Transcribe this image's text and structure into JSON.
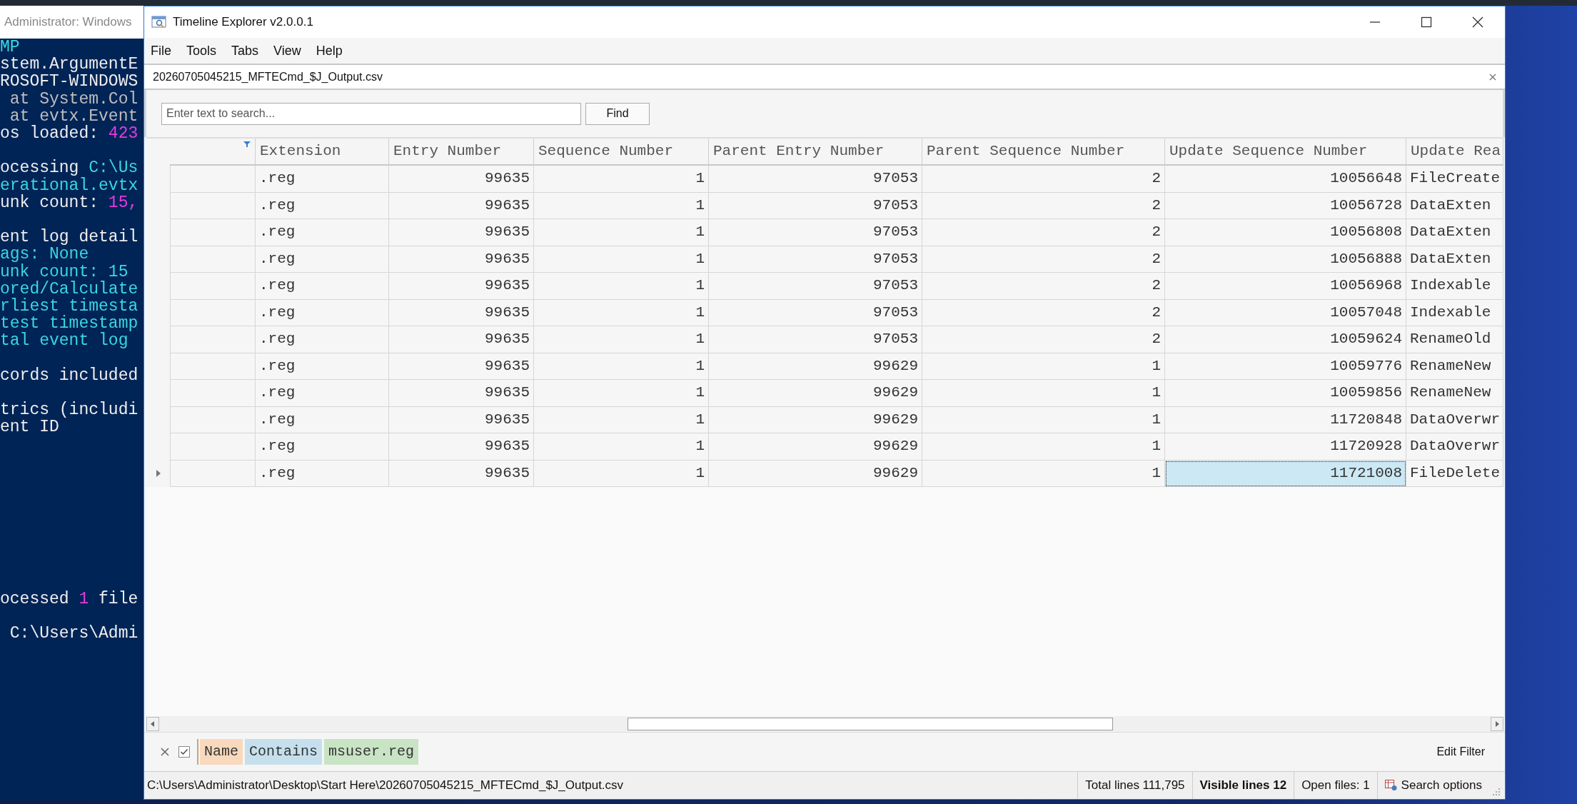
{
  "terminal": {
    "title": "Administrator: Windows",
    "blocks": [
      {
        "lines": [
          [
            {
              "text": "MP",
              "color": "#3ad6e0"
            }
          ],
          [
            {
              "text": "stem.ArgumentE",
              "color": "#eeeeee"
            }
          ],
          [
            {
              "text": "ROSOFT-WINDOWS",
              "color": "#eeeeee"
            }
          ],
          [
            {
              "text": " at System.Col",
              "color": "#bdbdbd"
            }
          ],
          [
            {
              "text": " at evtx.Event",
              "color": "#bdbdbd"
            }
          ],
          [
            {
              "text": "os loaded: ",
              "color": "#eeeeee"
            },
            {
              "text": "423",
              "color": "#e23be2"
            }
          ]
        ]
      },
      {
        "lines": [
          [
            {
              "text": "ocessing ",
              "color": "#eeeeee"
            },
            {
              "text": "C:\\Us",
              "color": "#3ad6e0"
            }
          ],
          [
            {
              "text": "erational.evtx",
              "color": "#3ad6e0"
            }
          ],
          [
            {
              "text": "unk count: ",
              "color": "#eeeeee"
            },
            {
              "text": "15,",
              "color": "#e23be2"
            }
          ]
        ]
      },
      {
        "lines": [
          [
            {
              "text": "ent log detail",
              "color": "#eeeeee"
            }
          ],
          [
            {
              "text": "ags: None",
              "color": "#3ad6e0"
            }
          ],
          [
            {
              "text": "unk count: 15",
              "color": "#3ad6e0"
            }
          ],
          [
            {
              "text": "ored/Calculate",
              "color": "#3ad6e0"
            }
          ],
          [
            {
              "text": "rliest timesta",
              "color": "#3ad6e0"
            }
          ],
          [
            {
              "text": "test timestamp",
              "color": "#3ad6e0"
            }
          ],
          [
            {
              "text": "tal event log",
              "color": "#3ad6e0"
            }
          ]
        ]
      },
      {
        "lines": [
          [
            {
              "text": "cords included",
              "color": "#eeeeee"
            }
          ]
        ]
      },
      {
        "lines": [
          [
            {
              "text": "trics (includi",
              "color": "#eeeeee"
            }
          ],
          [
            {
              "text": "ent ID",
              "color": "#eeeeee"
            }
          ]
        ]
      }
    ],
    "tail_blocks": [
      {
        "lines": [
          [
            {
              "text": "ocessed ",
              "color": "#eeeeee"
            },
            {
              "text": "1",
              "color": "#e23be2"
            },
            {
              "text": " file",
              "color": "#eeeeee"
            }
          ]
        ]
      },
      {
        "lines": [
          [
            {
              "text": " C:\\Users\\Admi",
              "color": "#eeeeee"
            }
          ]
        ]
      }
    ]
  },
  "window": {
    "title": "Timeline Explorer v2.0.0.1"
  },
  "menu": [
    "File",
    "Tools",
    "Tabs",
    "View",
    "Help"
  ],
  "tabs": [
    {
      "label": "20260705045215_MFTECmd_$J_Output.csv",
      "selected": true
    }
  ],
  "search": {
    "placeholder": "Enter text to search...",
    "button": "Find"
  },
  "table": {
    "columns": [
      {
        "kind": "filter"
      },
      {
        "label": "Extension",
        "kind": "text"
      },
      {
        "label": "Entry Number",
        "kind": "number"
      },
      {
        "label": "Sequence Number",
        "kind": "number"
      },
      {
        "label": "Parent Entry Number",
        "kind": "number"
      },
      {
        "label": "Parent Sequence Number",
        "kind": "number"
      },
      {
        "label": "Update Sequence Number",
        "kind": "number"
      },
      {
        "label": "Update Rea",
        "kind": "text"
      }
    ],
    "rows": [
      {
        "current": false,
        "cells": [
          {
            "text": "",
            "selected": false
          },
          {
            "text": ".reg",
            "selected": false
          },
          {
            "text": "99635",
            "selected": false
          },
          {
            "text": "1",
            "selected": false
          },
          {
            "text": "97053",
            "selected": false
          },
          {
            "text": "2",
            "selected": false
          },
          {
            "text": "10056648",
            "selected": false
          },
          {
            "text": "FileCreate",
            "selected": false
          }
        ]
      },
      {
        "current": false,
        "cells": [
          {
            "text": "",
            "selected": false
          },
          {
            "text": ".reg",
            "selected": false
          },
          {
            "text": "99635",
            "selected": false
          },
          {
            "text": "1",
            "selected": false
          },
          {
            "text": "97053",
            "selected": false
          },
          {
            "text": "2",
            "selected": false
          },
          {
            "text": "10056728",
            "selected": false
          },
          {
            "text": "DataExten",
            "selected": false
          }
        ]
      },
      {
        "current": false,
        "cells": [
          {
            "text": "",
            "selected": false
          },
          {
            "text": ".reg",
            "selected": false
          },
          {
            "text": "99635",
            "selected": false
          },
          {
            "text": "1",
            "selected": false
          },
          {
            "text": "97053",
            "selected": false
          },
          {
            "text": "2",
            "selected": false
          },
          {
            "text": "10056808",
            "selected": false
          },
          {
            "text": "DataExten",
            "selected": false
          }
        ]
      },
      {
        "current": false,
        "cells": [
          {
            "text": "",
            "selected": false
          },
          {
            "text": ".reg",
            "selected": false
          },
          {
            "text": "99635",
            "selected": false
          },
          {
            "text": "1",
            "selected": false
          },
          {
            "text": "97053",
            "selected": false
          },
          {
            "text": "2",
            "selected": false
          },
          {
            "text": "10056888",
            "selected": false
          },
          {
            "text": "DataExten",
            "selected": false
          }
        ]
      },
      {
        "current": false,
        "cells": [
          {
            "text": "",
            "selected": false
          },
          {
            "text": ".reg",
            "selected": false
          },
          {
            "text": "99635",
            "selected": false
          },
          {
            "text": "1",
            "selected": false
          },
          {
            "text": "97053",
            "selected": false
          },
          {
            "text": "2",
            "selected": false
          },
          {
            "text": "10056968",
            "selected": false
          },
          {
            "text": "Indexable",
            "selected": false
          }
        ]
      },
      {
        "current": false,
        "cells": [
          {
            "text": "",
            "selected": false
          },
          {
            "text": ".reg",
            "selected": false
          },
          {
            "text": "99635",
            "selected": false
          },
          {
            "text": "1",
            "selected": false
          },
          {
            "text": "97053",
            "selected": false
          },
          {
            "text": "2",
            "selected": false
          },
          {
            "text": "10057048",
            "selected": false
          },
          {
            "text": "Indexable",
            "selected": false
          }
        ]
      },
      {
        "current": false,
        "cells": [
          {
            "text": "",
            "selected": false
          },
          {
            "text": ".reg",
            "selected": false
          },
          {
            "text": "99635",
            "selected": false
          },
          {
            "text": "1",
            "selected": false
          },
          {
            "text": "97053",
            "selected": false
          },
          {
            "text": "2",
            "selected": false
          },
          {
            "text": "10059624",
            "selected": false
          },
          {
            "text": "RenameOld",
            "selected": false
          }
        ]
      },
      {
        "current": false,
        "cells": [
          {
            "text": "",
            "selected": false
          },
          {
            "text": ".reg",
            "selected": false
          },
          {
            "text": "99635",
            "selected": false
          },
          {
            "text": "1",
            "selected": false
          },
          {
            "text": "99629",
            "selected": false
          },
          {
            "text": "1",
            "selected": false
          },
          {
            "text": "10059776",
            "selected": false
          },
          {
            "text": "RenameNew",
            "selected": false
          }
        ]
      },
      {
        "current": false,
        "cells": [
          {
            "text": "",
            "selected": false
          },
          {
            "text": ".reg",
            "selected": false
          },
          {
            "text": "99635",
            "selected": false
          },
          {
            "text": "1",
            "selected": false
          },
          {
            "text": "99629",
            "selected": false
          },
          {
            "text": "1",
            "selected": false
          },
          {
            "text": "10059856",
            "selected": false
          },
          {
            "text": "RenameNew",
            "selected": false
          }
        ]
      },
      {
        "current": false,
        "cells": [
          {
            "text": "",
            "selected": false
          },
          {
            "text": ".reg",
            "selected": false
          },
          {
            "text": "99635",
            "selected": false
          },
          {
            "text": "1",
            "selected": false
          },
          {
            "text": "99629",
            "selected": false
          },
          {
            "text": "1",
            "selected": false
          },
          {
            "text": "11720848",
            "selected": false
          },
          {
            "text": "DataOverwr",
            "selected": false
          }
        ]
      },
      {
        "current": false,
        "cells": [
          {
            "text": "",
            "selected": false
          },
          {
            "text": ".reg",
            "selected": false
          },
          {
            "text": "99635",
            "selected": false
          },
          {
            "text": "1",
            "selected": false
          },
          {
            "text": "99629",
            "selected": false
          },
          {
            "text": "1",
            "selected": false
          },
          {
            "text": "11720928",
            "selected": false
          },
          {
            "text": "DataOverwr",
            "selected": false
          }
        ]
      },
      {
        "current": true,
        "cells": [
          {
            "text": "",
            "selected": false
          },
          {
            "text": ".reg",
            "selected": false
          },
          {
            "text": "99635",
            "selected": false
          },
          {
            "text": "1",
            "selected": false
          },
          {
            "text": "99629",
            "selected": false
          },
          {
            "text": "1",
            "selected": false
          },
          {
            "text": "11721008",
            "selected": true
          },
          {
            "text": "FileDelete",
            "selected": false
          }
        ]
      }
    ]
  },
  "filter": {
    "enabled": true,
    "terms": [
      {
        "text": "Name",
        "color": "#f8d9be"
      },
      {
        "text": "Contains",
        "color": "#c5e0ec"
      },
      {
        "text": "msuser.reg",
        "color": "#c9e3c5"
      }
    ],
    "edit_label": "Edit Filter"
  },
  "status_bar": {
    "path": "C:\\Users\\Administrator\\Desktop\\Start Here\\20260705045215_MFTECmd_$J_Output.csv",
    "items": [
      {
        "text": "Total lines 111,795",
        "kind": "plain"
      },
      {
        "text": "Visible lines 12",
        "kind": "bold"
      },
      {
        "text": "Open files: 1",
        "kind": "plain"
      },
      {
        "text": "Search options",
        "kind": "options"
      }
    ]
  }
}
